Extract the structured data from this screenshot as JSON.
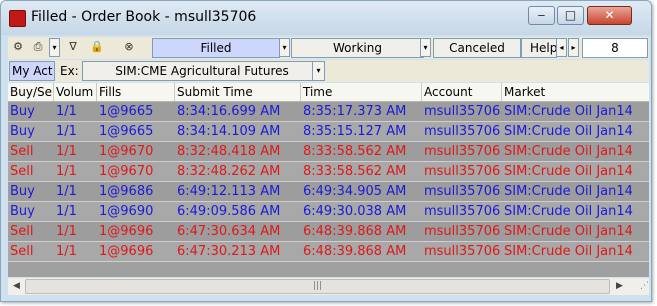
{
  "window": {
    "title": "Filled - Order Book - msull35706"
  },
  "toolbar": {
    "tabs": [
      "Filled",
      "Working",
      "Canceled",
      "Help"
    ],
    "active_tab": "Filled",
    "count": "8"
  },
  "account_bar": {
    "my_act_label": "My Act",
    "exchange_label": "Ex:",
    "exchange_value": "SIM:CME Agricultural Futures"
  },
  "table": {
    "columns": [
      "Buy/Se",
      "Volum",
      "Fills",
      "Submit Time",
      "Time",
      "Account",
      "Market"
    ],
    "rows": [
      [
        "Buy",
        "1/1",
        "1@9665",
        "8:34:16.699 AM",
        "8:35:17.373 AM",
        "msull35706",
        "SIM:Crude Oil Jan14"
      ],
      [
        "Buy",
        "1/1",
        "1@9665",
        "8:34:14.109 AM",
        "8:35:15.127 AM",
        "msull35706",
        "SIM:Crude Oil Jan14"
      ],
      [
        "Sell",
        "1/1",
        "1@9670",
        "8:32:48.418 AM",
        "8:33:58.562 AM",
        "msull35706",
        "SIM:Crude Oil Jan14"
      ],
      [
        "Sell",
        "1/1",
        "1@9670",
        "8:32:48.262 AM",
        "8:33:58.562 AM",
        "msull35706",
        "SIM:Crude Oil Jan14"
      ],
      [
        "Buy",
        "1/1",
        "1@9686",
        "6:49:12.113 AM",
        "6:49:34.905 AM",
        "msull35706",
        "SIM:Crude Oil Jan14"
      ],
      [
        "Buy",
        "1/1",
        "1@9690",
        "6:49:09.586 AM",
        "6:49:30.038 AM",
        "msull35706",
        "SIM:Crude Oil Jan14"
      ],
      [
        "Sell",
        "1/1",
        "1@9696",
        "6:47:30.634 AM",
        "6:48:39.868 AM",
        "msull35706",
        "SIM:Crude Oil Jan14"
      ],
      [
        "Sell",
        "1/1",
        "1@9696",
        "6:47:30.213 AM",
        "6:48:39.868 AM",
        "msull35706",
        "SIM:Crude Oil Jan14"
      ]
    ]
  },
  "colors": {
    "buy": "#1a1adb",
    "sell": "#e01818",
    "row_bg_a": "#9d9d9d",
    "row_bg_b": "#a8a8a8"
  },
  "icons": [
    "app-icon",
    "settings-icon",
    "print-icon",
    "filter-icon",
    "lock-icon",
    "cancel-icon",
    "scroll-left-icon",
    "scroll-right-icon"
  ]
}
